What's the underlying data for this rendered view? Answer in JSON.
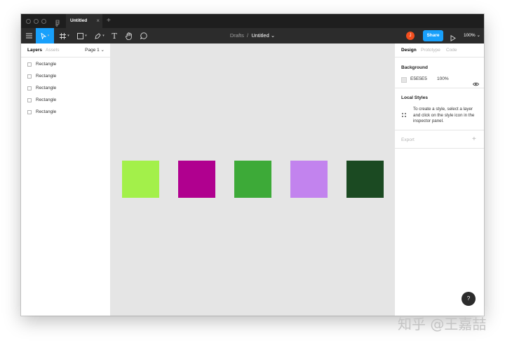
{
  "titlebar": {
    "tab_title": "Untitled",
    "tab_close": "×",
    "tab_add": "+"
  },
  "toolbar": {
    "breadcrumb_project": "Drafts",
    "breadcrumb_sep": "/",
    "breadcrumb_file": "Untitled",
    "breadcrumb_caret": "⌄",
    "avatar_initial": "J",
    "share_label": "Share",
    "zoom_label": "100%",
    "zoom_caret": "⌄",
    "text_tool_glyph": "T",
    "caret": "▾"
  },
  "left_panel": {
    "tabs": [
      {
        "label": "Layers",
        "active": true
      },
      {
        "label": "Assets",
        "active": false
      }
    ],
    "page_selector": "Page 1 ⌄",
    "layers": [
      {
        "label": "Rectangle"
      },
      {
        "label": "Rectangle"
      },
      {
        "label": "Rectangle"
      },
      {
        "label": "Rectangle"
      },
      {
        "label": "Rectangle"
      }
    ]
  },
  "canvas": {
    "background": "#E5E5E5",
    "shapes": [
      {
        "fill": "#A3F04A"
      },
      {
        "fill": "#B0008F"
      },
      {
        "fill": "#3DAA38"
      },
      {
        "fill": "#C283EE"
      },
      {
        "fill": "#1B4A22"
      }
    ]
  },
  "right_panel": {
    "tabs": [
      {
        "label": "Design",
        "active": true
      },
      {
        "label": "Prototype",
        "active": false
      },
      {
        "label": "Code",
        "active": false
      }
    ],
    "background": {
      "title": "Background",
      "hex": "E5E5E5",
      "opacity": "100%"
    },
    "local_styles": {
      "title": "Local Styles",
      "hint": "To create a style, select a layer and click on the style icon in the inspector panel."
    },
    "export": {
      "label": "Export",
      "add": "+"
    },
    "help_label": "?"
  },
  "watermark": "知乎 @王嘉喆"
}
